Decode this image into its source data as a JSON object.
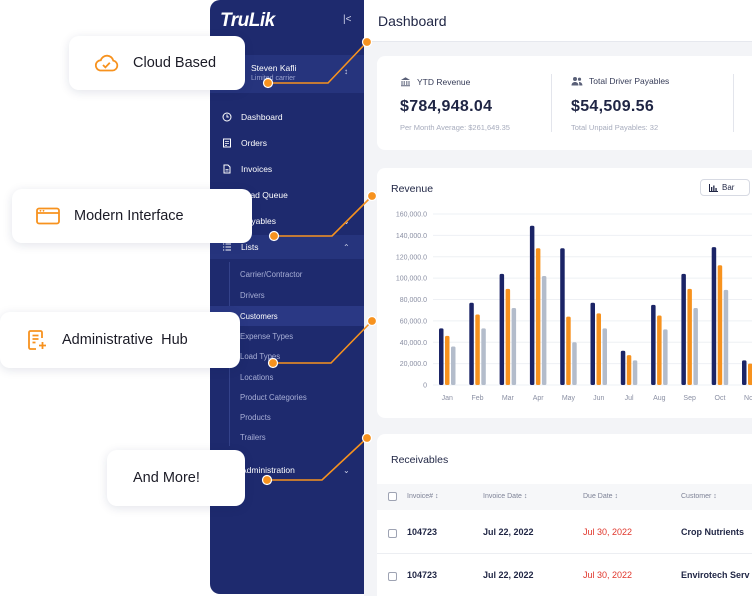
{
  "app": {
    "logo": "TruLik"
  },
  "sidebar": {
    "collapse_icon": "collapse-icon",
    "user": {
      "name": "Steven Kafli",
      "role": "Limited carrier"
    },
    "items": [
      {
        "label": "Dashboard",
        "icon": "clock-icon"
      },
      {
        "label": "Orders",
        "icon": "orders-icon"
      },
      {
        "label": "Invoices",
        "icon": "invoice-icon"
      },
      {
        "label": "Load Queue",
        "icon": "queue-icon"
      },
      {
        "label": "Payables",
        "icon": "payables-icon"
      },
      {
        "label": "Lists",
        "icon": "list-icon"
      }
    ],
    "sub_items": [
      {
        "label": "Carrier/Contractor"
      },
      {
        "label": "Drivers"
      },
      {
        "label": "Customers"
      },
      {
        "label": "Expense Types"
      },
      {
        "label": "Load Types"
      },
      {
        "label": "Locations"
      },
      {
        "label": "Product Categories"
      },
      {
        "label": "Products"
      },
      {
        "label": "Trailers"
      }
    ],
    "admin": {
      "label": "Administration"
    }
  },
  "header": {
    "title": "Dashboard"
  },
  "stats": [
    {
      "label": "YTD Revenue",
      "value": "$784,948.04",
      "sub": "Per Month Average: $261,649.35",
      "icon": "bank-icon"
    },
    {
      "label": "Total Driver Payables",
      "value": "$54,509.56",
      "sub": "Total Unpaid Payables: 32",
      "icon": "users-icon"
    }
  ],
  "revenue": {
    "title": "Revenue",
    "toggle_label": "Bar",
    "colors": {
      "navy": "#1b2466",
      "orange": "#f7921e",
      "gray": "#b3bccb"
    }
  },
  "chart_data": {
    "type": "bar",
    "categories": [
      "Jan",
      "Feb",
      "Mar",
      "Apr",
      "May",
      "Jun",
      "Jul",
      "Aug",
      "Sep",
      "Oct",
      "Nov"
    ],
    "series": [
      {
        "values": [
          53000,
          77000,
          104000,
          149000,
          128000,
          77000,
          32000,
          75000,
          104000,
          129000,
          23000
        ]
      },
      {
        "values": [
          46000,
          66000,
          90000,
          128000,
          64000,
          67000,
          28000,
          65000,
          90000,
          112000,
          20000
        ]
      },
      {
        "values": [
          36000,
          53000,
          72000,
          102000,
          40000,
          53000,
          23000,
          52000,
          72000,
          89000,
          18000
        ]
      }
    ],
    "yticks": [
      "0",
      "20,000.0",
      "40,000.0",
      "60,000.0",
      "80,000.0",
      "100,000.0",
      "120,000.0",
      "140,000.0",
      "160,000.0"
    ],
    "ylim": [
      0,
      160000
    ],
    "grid": true
  },
  "receivables": {
    "title": "Receivables",
    "columns": [
      "Invoice#",
      "Invoice Date",
      "Due Date",
      "Customer"
    ],
    "rows": [
      {
        "invoice": "104723",
        "invoice_date": "Jul 22, 2022",
        "due_date": "Jul 30, 2022",
        "customer": "Crop Nutrients"
      },
      {
        "invoice": "104723",
        "invoice_date": "Jul 22, 2022",
        "due_date": "Jul 30, 2022",
        "customer": "Envirotech Serv"
      }
    ]
  },
  "callouts": [
    {
      "label": "Cloud Based",
      "icon": "cloud-check-icon"
    },
    {
      "label": "Modern Interface",
      "icon": "window-icon"
    },
    {
      "label": "Administrative  Hub",
      "icon": "document-edit-icon"
    },
    {
      "label": "And More!"
    }
  ],
  "accent": "#f7921e"
}
